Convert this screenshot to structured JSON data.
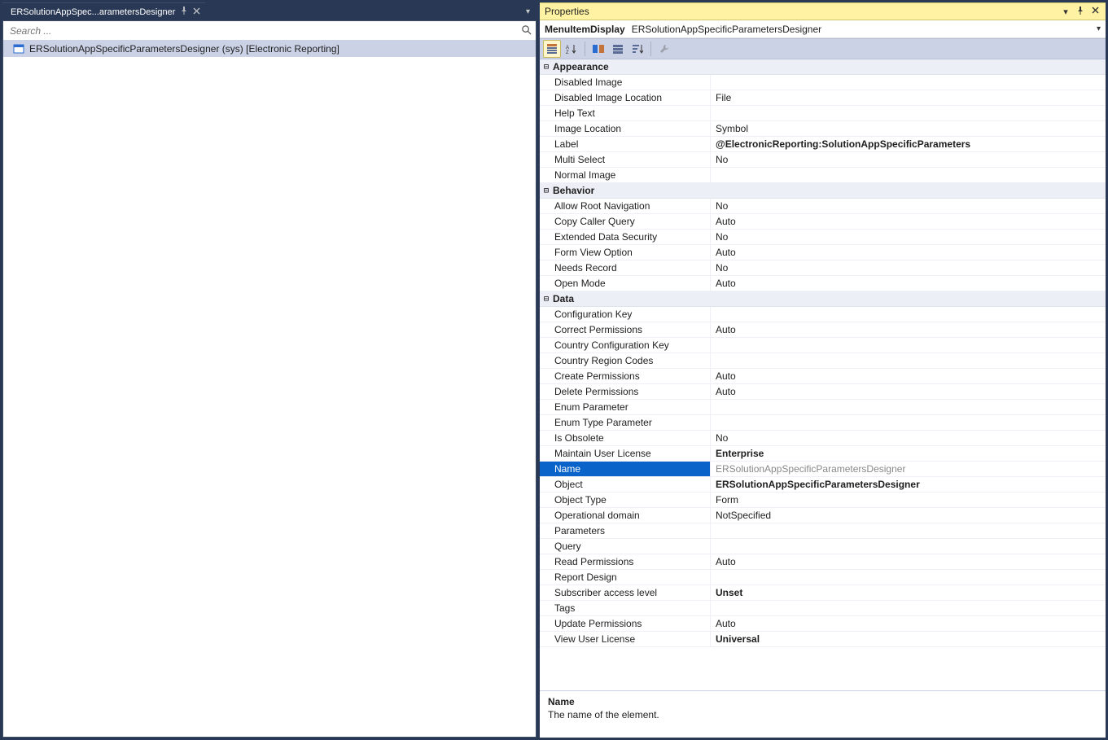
{
  "tab": {
    "title": "ERSolutionAppSpec...arametersDesigner"
  },
  "search": {
    "placeholder": "Search ..."
  },
  "tree": {
    "row_label": "ERSolutionAppSpecificParametersDesigner (sys) [Electronic Reporting]"
  },
  "properties": {
    "panel_title": "Properties",
    "header_type": "MenuItemDisplay",
    "header_name": "ERSolutionAppSpecificParametersDesigner"
  },
  "categories": [
    {
      "name": "Appearance",
      "rows": [
        {
          "n": "Disabled Image",
          "v": ""
        },
        {
          "n": "Disabled Image Location",
          "v": "File"
        },
        {
          "n": "Help Text",
          "v": ""
        },
        {
          "n": "Image Location",
          "v": "Symbol"
        },
        {
          "n": "Label",
          "v": "@ElectronicReporting:SolutionAppSpecificParameters",
          "bold": true
        },
        {
          "n": "Multi Select",
          "v": "No"
        },
        {
          "n": "Normal Image",
          "v": ""
        }
      ]
    },
    {
      "name": "Behavior",
      "rows": [
        {
          "n": "Allow Root Navigation",
          "v": "No"
        },
        {
          "n": "Copy Caller Query",
          "v": "Auto"
        },
        {
          "n": "Extended Data Security",
          "v": "No"
        },
        {
          "n": "Form View Option",
          "v": "Auto"
        },
        {
          "n": "Needs Record",
          "v": "No"
        },
        {
          "n": "Open Mode",
          "v": "Auto"
        }
      ]
    },
    {
      "name": "Data",
      "rows": [
        {
          "n": "Configuration Key",
          "v": ""
        },
        {
          "n": "Correct Permissions",
          "v": "Auto"
        },
        {
          "n": "Country Configuration Key",
          "v": ""
        },
        {
          "n": "Country Region Codes",
          "v": ""
        },
        {
          "n": "Create Permissions",
          "v": "Auto"
        },
        {
          "n": "Delete Permissions",
          "v": "Auto"
        },
        {
          "n": "Enum Parameter",
          "v": ""
        },
        {
          "n": "Enum Type Parameter",
          "v": ""
        },
        {
          "n": "Is Obsolete",
          "v": "No"
        },
        {
          "n": "Maintain User License",
          "v": "Enterprise",
          "bold": true
        },
        {
          "n": "Name",
          "v": "ERSolutionAppSpecificParametersDesigner",
          "sel": true
        },
        {
          "n": "Object",
          "v": "ERSolutionAppSpecificParametersDesigner",
          "bold": true
        },
        {
          "n": "Object Type",
          "v": "Form"
        },
        {
          "n": "Operational domain",
          "v": "NotSpecified"
        },
        {
          "n": "Parameters",
          "v": ""
        },
        {
          "n": "Query",
          "v": ""
        },
        {
          "n": "Read Permissions",
          "v": "Auto"
        },
        {
          "n": "Report Design",
          "v": ""
        },
        {
          "n": "Subscriber access level",
          "v": "Unset",
          "bold": true
        },
        {
          "n": "Tags",
          "v": ""
        },
        {
          "n": "Update Permissions",
          "v": "Auto"
        },
        {
          "n": "View User License",
          "v": "Universal",
          "bold": true
        }
      ]
    }
  ],
  "description": {
    "name": "Name",
    "text": "The name of the element."
  }
}
